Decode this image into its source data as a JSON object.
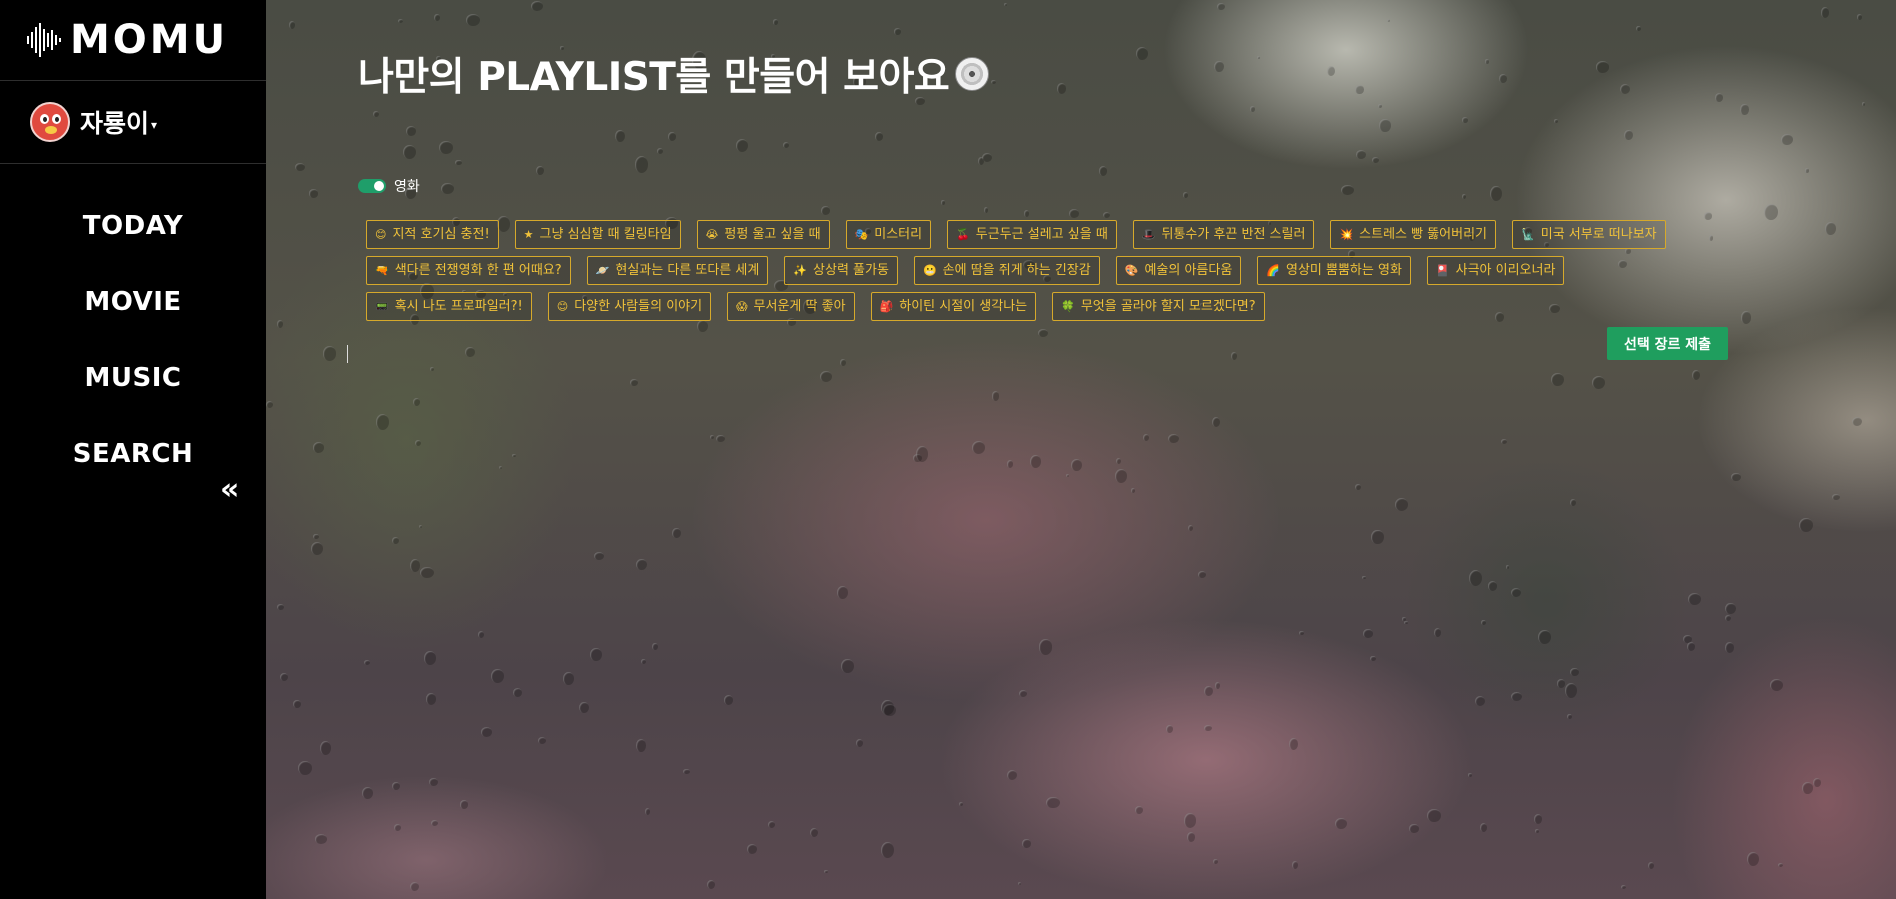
{
  "sidebar": {
    "logo_text": "MOMU",
    "user": {
      "name": "자룡이",
      "caret": "▾"
    },
    "nav": [
      "TODAY",
      "MOVIE",
      "MUSIC",
      "SEARCH"
    ],
    "collapse_label": "«"
  },
  "main": {
    "title": "나만의 PLAYLIST를 만들어 보아요",
    "toggle": {
      "label": "영화",
      "on": true
    },
    "chip_rows": [
      [
        {
          "icon": "😊",
          "label": "지적 호기심 충전!"
        },
        {
          "icon": "★",
          "label": "그냥 심심할 때 킬링타임"
        },
        {
          "icon": "😭",
          "label": "펑펑 울고 싶을 때"
        },
        {
          "icon": "🎭",
          "label": "미스터리"
        },
        {
          "icon": "🍒",
          "label": "두근두근 설레고 싶을 때"
        },
        {
          "icon": "🎩",
          "label": "뒤통수가 후끈 반전 스릴러"
        },
        {
          "icon": "💥",
          "label": "스트레스 빵 뚫어버리기"
        },
        {
          "icon": "🗽",
          "label": "미국 서부로 떠나보자"
        }
      ],
      [
        {
          "icon": "🔫",
          "label": "색다른 전쟁영화 한 편 어때요?"
        },
        {
          "icon": "🪐",
          "label": "현실과는 다른 또다른 세계"
        },
        {
          "icon": "✨",
          "label": "상상력 풀가동"
        },
        {
          "icon": "😬",
          "label": "손에 땀을 쥐게 하는 긴장감"
        },
        {
          "icon": "🎨",
          "label": "예술의 아름다움"
        },
        {
          "icon": "🌈",
          "label": "영상미 뿜뿜하는 영화"
        },
        {
          "icon": "🎴",
          "label": "사극아 이리오너라"
        }
      ],
      [
        {
          "icon": "📟",
          "label": "혹시 나도 프로파일러?!"
        },
        {
          "icon": "😊",
          "label": "다양한 사람들의 이야기"
        },
        {
          "icon": "😱",
          "label": "무서운게 딱 좋아"
        },
        {
          "icon": "🎒",
          "label": "하이틴 시절이 생각나는"
        },
        {
          "icon": "🍀",
          "label": "무엇을 골라야 할지 모르겠다면?"
        }
      ]
    ],
    "submit_label": "선택 장르 제출"
  },
  "colors": {
    "sidebar_bg": "#000000",
    "chip_text": "#f0c23a",
    "accent_green": "#1f9e5e"
  },
  "icons": {
    "logo": "sound-wave-icon",
    "title": "disc-icon",
    "collapse": "double-chevron-left-icon"
  }
}
